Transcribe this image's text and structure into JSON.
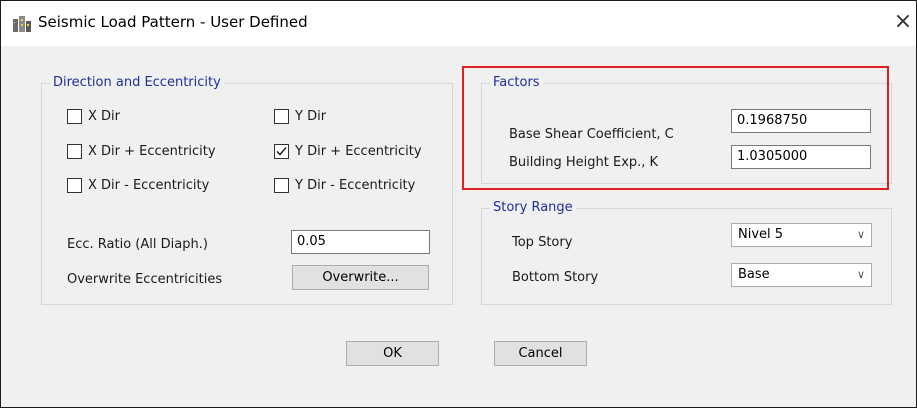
{
  "window": {
    "title": "Seismic Load Pattern - User Defined",
    "close": "×"
  },
  "direction": {
    "title": "Direction and Eccentricity",
    "options": [
      {
        "label": "X Dir",
        "checked": false
      },
      {
        "label": "Y Dir",
        "checked": false
      },
      {
        "label": "X Dir + Eccentricity",
        "checked": false
      },
      {
        "label": "Y Dir + Eccentricity",
        "checked": true
      },
      {
        "label": "X Dir - Eccentricity",
        "checked": false
      },
      {
        "label": "Y Dir - Eccentricity",
        "checked": false
      }
    ],
    "ecc_ratio_label": "Ecc. Ratio (All Diaph.)",
    "ecc_ratio_value": "0.05",
    "overwrite_label": "Overwrite Eccentricities",
    "overwrite_button": "Overwrite..."
  },
  "factors": {
    "title": "Factors",
    "base_shear_label": "Base Shear Coefficient, C",
    "base_shear_value": "0.1968750",
    "height_exp_label": "Building Height Exp., K",
    "height_exp_value": "1.0305000"
  },
  "story_range": {
    "title": "Story Range",
    "top_label": "Top Story",
    "top_value": "Nivel 5",
    "bottom_label": "Bottom Story",
    "bottom_value": "Base"
  },
  "buttons": {
    "ok": "OK",
    "cancel": "Cancel"
  },
  "colors": {
    "group_title": "#1e2f9a",
    "highlight": "#e02020"
  }
}
